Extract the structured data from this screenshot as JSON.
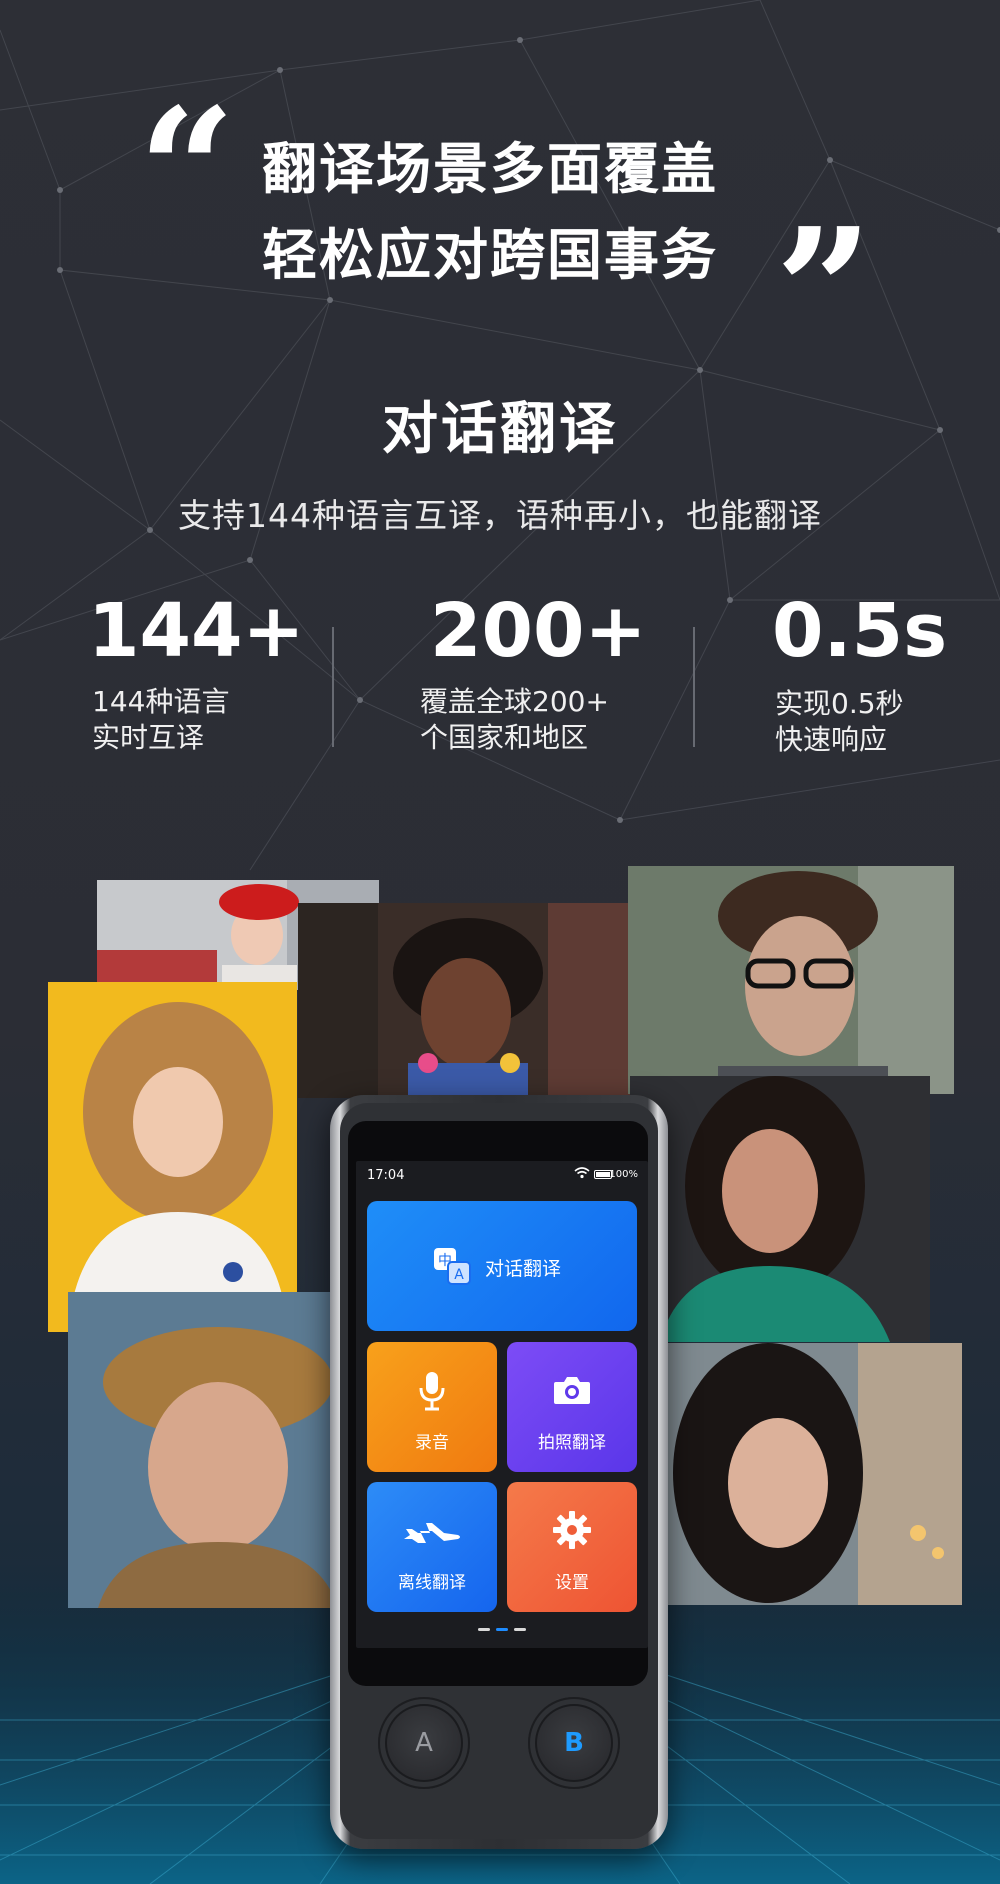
{
  "headline": {
    "open_quote": "“",
    "close_quote": "”",
    "line1": "翻译场景多面覆盖",
    "line2": "轻松应对跨国事务"
  },
  "section": {
    "title": "对话翻译",
    "subtitle": "支持144种语言互译，语种再小，也能翻译"
  },
  "stats": [
    {
      "value": "144+",
      "line1": "144种语言",
      "line2": "实时互译"
    },
    {
      "value": "200+",
      "line1": "覆盖全球200+",
      "line2": "个国家和地区"
    },
    {
      "value": "0.5s",
      "line1": "实现0.5秒",
      "line2": "快速响应"
    }
  ],
  "device": {
    "status_time": "17:04",
    "battery_text": "100%",
    "tiles": {
      "dialog": {
        "label": "对话翻译",
        "icon": "translate-icon"
      },
      "record": {
        "label": "录音",
        "icon": "microphone-icon"
      },
      "photo": {
        "label": "拍照翻译",
        "icon": "camera-icon"
      },
      "offline": {
        "label": "离线翻译",
        "icon": "airplane-icon"
      },
      "settings": {
        "label": "设置",
        "icon": "gear-icon"
      }
    },
    "translate_icon_text": {
      "top": "中",
      "bottom": "A"
    },
    "buttons": {
      "a": "A",
      "b": "B"
    },
    "page_indicator": {
      "count": 3,
      "active": 2
    }
  },
  "colors": {
    "background": "#2a2c33",
    "tile_blue": "#1a7df4",
    "tile_orange": "#f28a14",
    "tile_purple": "#6b40ef",
    "tile_red": "#f0633c",
    "button_b_accent": "#1e9bff"
  }
}
